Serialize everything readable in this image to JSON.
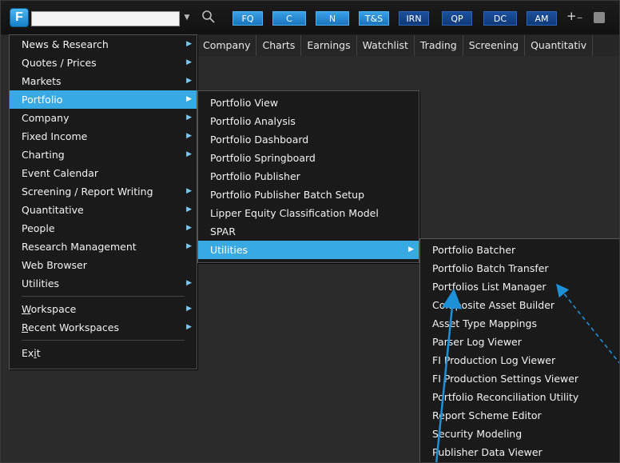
{
  "toolbar": {
    "logo_letter": "F",
    "command_input_value": "",
    "buttons": [
      "FQ",
      "C",
      "N",
      "T&S",
      "IRN",
      "QP",
      "DC",
      "AM"
    ],
    "plus_minus": "+₋"
  },
  "nav": {
    "items": [
      "Company",
      "Charts",
      "Earnings",
      "Watchlist",
      "Trading",
      "Screening",
      "Quantitativ"
    ]
  },
  "main_menu": {
    "items": [
      {
        "label": "News & Research"
      },
      {
        "label": "Quotes / Prices"
      },
      {
        "label": "Markets"
      },
      {
        "label": "Portfolio"
      },
      {
        "label": "Company"
      },
      {
        "label": "Fixed Income"
      },
      {
        "label": "Charting"
      },
      {
        "label": "Event Calendar"
      },
      {
        "label": "Screening / Report Writing"
      },
      {
        "label": "Quantitative"
      },
      {
        "label": "People"
      },
      {
        "label": "Research Management"
      },
      {
        "label": "Web Browser"
      },
      {
        "label": "Utilities"
      }
    ],
    "workspace_first": "W",
    "workspace_rest": "orkspace",
    "recent_first": "R",
    "recent_rest": "ecent Workspaces",
    "exit_first": "Ex",
    "exit_under": "i",
    "exit_rest": "t"
  },
  "portfolio_menu": {
    "items": [
      "Portfolio View",
      "Portfolio Analysis",
      "Portfolio Dashboard",
      "Portfolio Springboard",
      "Portfolio Publisher",
      "Portfolio Publisher Batch Setup",
      "Lipper Equity Classification Model",
      "SPAR",
      "Utilities"
    ]
  },
  "utilities_menu": {
    "items": [
      "Portfolio Batcher",
      "Portfolio Batch Transfer",
      "Portfolios List Manager",
      "Composite Asset Builder",
      "Asset Type Mappings",
      "Parser Log Viewer",
      "FI Production Log Viewer",
      "FI Production Settings Viewer",
      "Portfolio Reconciliation Utility",
      "Report Scheme Editor",
      "Security Modeling",
      "Publisher Data Viewer"
    ]
  },
  "colors": {
    "highlight": "#38a9e3",
    "annotation_arrow": "#1e90d8",
    "background": "#2b2b2b"
  }
}
